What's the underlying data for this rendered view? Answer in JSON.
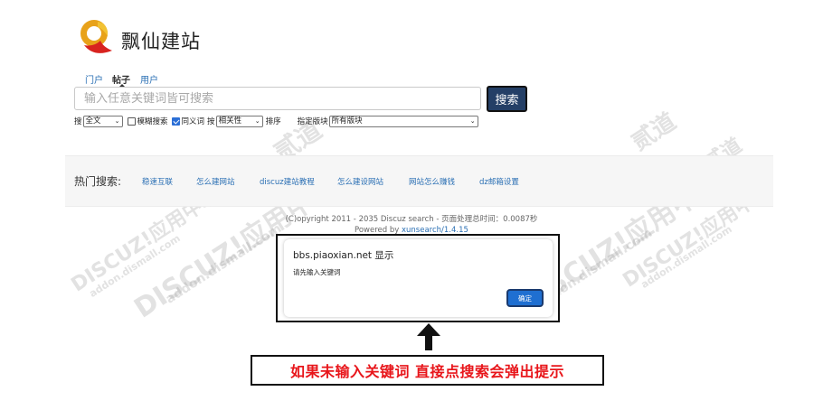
{
  "brand": {
    "name": "飘仙建站"
  },
  "tabs": [
    {
      "label": "门户"
    },
    {
      "label": "帖子"
    },
    {
      "label": "用户"
    }
  ],
  "search": {
    "placeholder": "输入任意关键词皆可搜索",
    "button_label": "搜索"
  },
  "options": {
    "search_label": "搜",
    "scope_value": "全文",
    "fuzzy_label": "模糊搜索",
    "synonym_label": "同义词",
    "by_label": "按",
    "sort_value": "相关性",
    "sort_label": "排序",
    "board_label": "指定版块",
    "board_value": "所有版块"
  },
  "hot": {
    "label": "热门搜索:",
    "links": [
      "稳速互联",
      "怎么建网站",
      "discuz建站教程",
      "怎么建设网站",
      "网站怎么赚钱",
      "dz邮箱设置"
    ]
  },
  "footer": {
    "copyright": "(C)opyright 2011 - 2035 Discuz search - 页面处理总时间：0.0087秒",
    "powered_prefix": "Powered by ",
    "powered_link": "xunsearch/1.4.15"
  },
  "dialog": {
    "title": "bbs.piaoxian.net 显示",
    "message": "请先输入关键词",
    "ok_label": "确定"
  },
  "annotation": {
    "arrow_icon": "up-arrow-icon",
    "note": "如果未输入关键词 直接点搜索会弹出提示"
  },
  "watermark": {
    "main": "DISCUZ!应用中心",
    "site": "addon.dismall.com",
    "brand": "贰道"
  },
  "colors": {
    "accent": "#243f66",
    "link": "#2a6fb4",
    "note_red": "#e8161b",
    "ok_button": "#1f6fd1"
  }
}
